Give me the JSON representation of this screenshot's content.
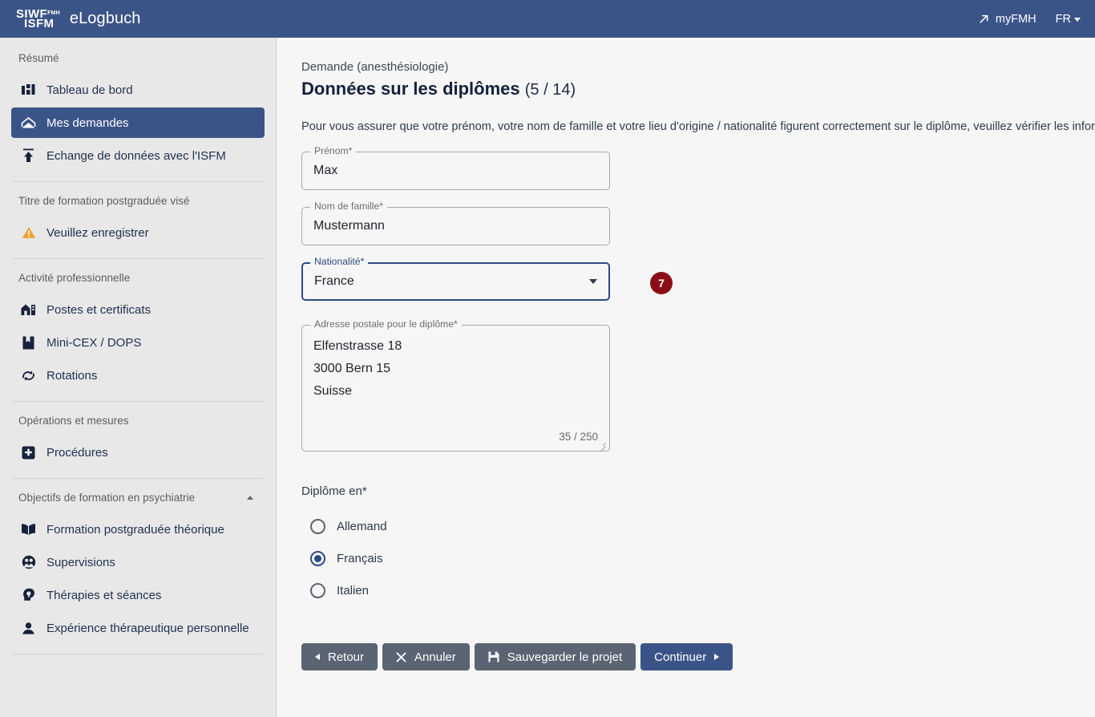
{
  "header": {
    "logo_line1": "SIWF",
    "logo_sup": "FMH",
    "logo_line2": "ISFM",
    "app_title": "eLogbuch",
    "myfmh_label": "myFMH",
    "lang_label": "FR"
  },
  "sidebar": {
    "sections": [
      {
        "title": "Résumé",
        "collapsible": false,
        "items": [
          {
            "label": "Tableau de bord",
            "icon": "dashboard-icon",
            "active": false
          },
          {
            "label": "Mes demandes",
            "icon": "inbox-icon",
            "active": true
          },
          {
            "label": "Echange de données avec l'ISFM",
            "icon": "upload-icon",
            "active": false
          }
        ]
      },
      {
        "title": "Titre de formation postgraduée visé",
        "collapsible": false,
        "items": [
          {
            "label": "Veuillez enregistrer",
            "icon": "warning-icon",
            "active": false
          }
        ]
      },
      {
        "title": "Activité professionnelle",
        "collapsible": false,
        "items": [
          {
            "label": "Postes et certificats",
            "icon": "building-icon",
            "active": false
          },
          {
            "label": "Mini-CEX / DOPS",
            "icon": "bookmark-icon",
            "active": false
          },
          {
            "label": "Rotations",
            "icon": "rotate-icon",
            "active": false
          }
        ]
      },
      {
        "title": "Opérations et mesures",
        "collapsible": false,
        "items": [
          {
            "label": "Procédures",
            "icon": "medical-cross-icon",
            "active": false
          }
        ]
      },
      {
        "title": "Objectifs de formation en psychiatrie",
        "collapsible": true,
        "items": [
          {
            "label": "Formation postgraduée théorique",
            "icon": "book-icon",
            "active": false
          },
          {
            "label": "Supervisions",
            "icon": "people-circle-icon",
            "active": false
          },
          {
            "label": "Thérapies et séances",
            "icon": "head-idea-icon",
            "active": false
          },
          {
            "label": "Expérience thérapeutique personnelle",
            "icon": "person-icon",
            "active": false
          }
        ]
      }
    ]
  },
  "main": {
    "breadcrumb": "Demande (anesthésiologie)",
    "title": "Données sur les diplômes",
    "step_counter": "(5 / 14)",
    "intro": "Pour vous assurer que votre prénom, votre nom de famille et votre lieu d'origine / nationalité figurent correctement sur le diplôme, veuillez vérifier les inform",
    "fields": {
      "firstname": {
        "label": "Prénom*",
        "value": "Max"
      },
      "lastname": {
        "label": "Nom de famille*",
        "value": "Mustermann"
      },
      "nationality": {
        "label": "Nationalité*",
        "value": "France",
        "badge": "7"
      },
      "address": {
        "label": "Adresse postale pour le diplôme*",
        "lines": [
          "Elfenstrasse 18",
          "3000 Bern 15",
          "Suisse"
        ],
        "counter": "35 / 250"
      }
    },
    "radio_group": {
      "label": "Diplôme en*",
      "options": [
        {
          "label": "Allemand",
          "checked": false
        },
        {
          "label": "Français",
          "checked": true
        },
        {
          "label": "Italien",
          "checked": false
        }
      ]
    },
    "buttons": [
      {
        "label": "Retour",
        "icon": "chevron-left-icon",
        "style": "default"
      },
      {
        "label": "Annuler",
        "icon": "close-icon",
        "style": "default"
      },
      {
        "label": "Sauvegarder le projet",
        "icon": "save-icon",
        "style": "default"
      },
      {
        "label": "Continuer",
        "icon": "chevron-right-icon",
        "style": "primary"
      }
    ]
  },
  "colors": {
    "brand_blue": "#3b5488",
    "focus_blue": "#2d4b82",
    "badge_red": "#8b0e18",
    "button_gray": "#5a6472",
    "sidebar_bg": "#e8e8e8",
    "main_bg": "#f6f6f6",
    "warning_amber": "#f0a22e"
  }
}
